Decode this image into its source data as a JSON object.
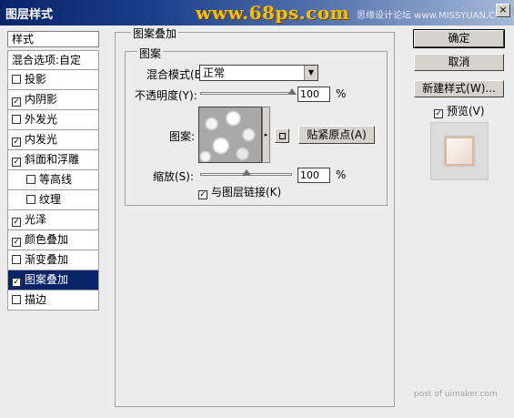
{
  "window": {
    "title": "图层样式",
    "watermark_logo": "www.68ps.com",
    "watermark_site": "思缘设计论坛 www.MISSYUAN.COM",
    "close_glyph": "×",
    "footer_watermark": "post of uimaker.com"
  },
  "sidebar": {
    "header": "样式",
    "items": [
      {
        "label": "混合选项:自定",
        "checkbox": false
      },
      {
        "label": "投影",
        "checkbox": true,
        "checked": false
      },
      {
        "label": "内阴影",
        "checkbox": true,
        "checked": true
      },
      {
        "label": "外发光",
        "checkbox": true,
        "checked": false
      },
      {
        "label": "内发光",
        "checkbox": true,
        "checked": true
      },
      {
        "label": "斜面和浮雕",
        "checkbox": true,
        "checked": true
      },
      {
        "label": "等高线",
        "checkbox": true,
        "checked": false,
        "sub": true
      },
      {
        "label": "纹理",
        "checkbox": true,
        "checked": false,
        "sub": true
      },
      {
        "label": "光泽",
        "checkbox": true,
        "checked": true
      },
      {
        "label": "颜色叠加",
        "checkbox": true,
        "checked": true
      },
      {
        "label": "渐变叠加",
        "checkbox": true,
        "checked": false
      },
      {
        "label": "图案叠加",
        "checkbox": true,
        "checked": true,
        "selected": true
      },
      {
        "label": "描边",
        "checkbox": true,
        "checked": false
      }
    ]
  },
  "panel": {
    "group_title": "图案叠加",
    "inner_title": "图案",
    "blend_mode_label": "混合模式(B):",
    "blend_mode_value": "正常",
    "opacity_label": "不透明度(Y):",
    "opacity_value": "100",
    "opacity_unit": "%",
    "opacity_level": 1.0,
    "pattern_label": "图案:",
    "snap_origin_button": "贴紧原点(A)",
    "scale_label": "缩放(S):",
    "scale_value": "100",
    "scale_unit": "%",
    "scale_level": 0.5,
    "link_layer_label": "与图层链接(K)",
    "link_layer_checked": true
  },
  "buttons": {
    "ok": "确定",
    "cancel": "取消",
    "new_style": "新建样式(W)...",
    "preview_label": "预览(V)",
    "preview_checked": true
  },
  "check_glyph": "✓",
  "dropdown_glyph": "▼",
  "flyout_glyph": "▸"
}
